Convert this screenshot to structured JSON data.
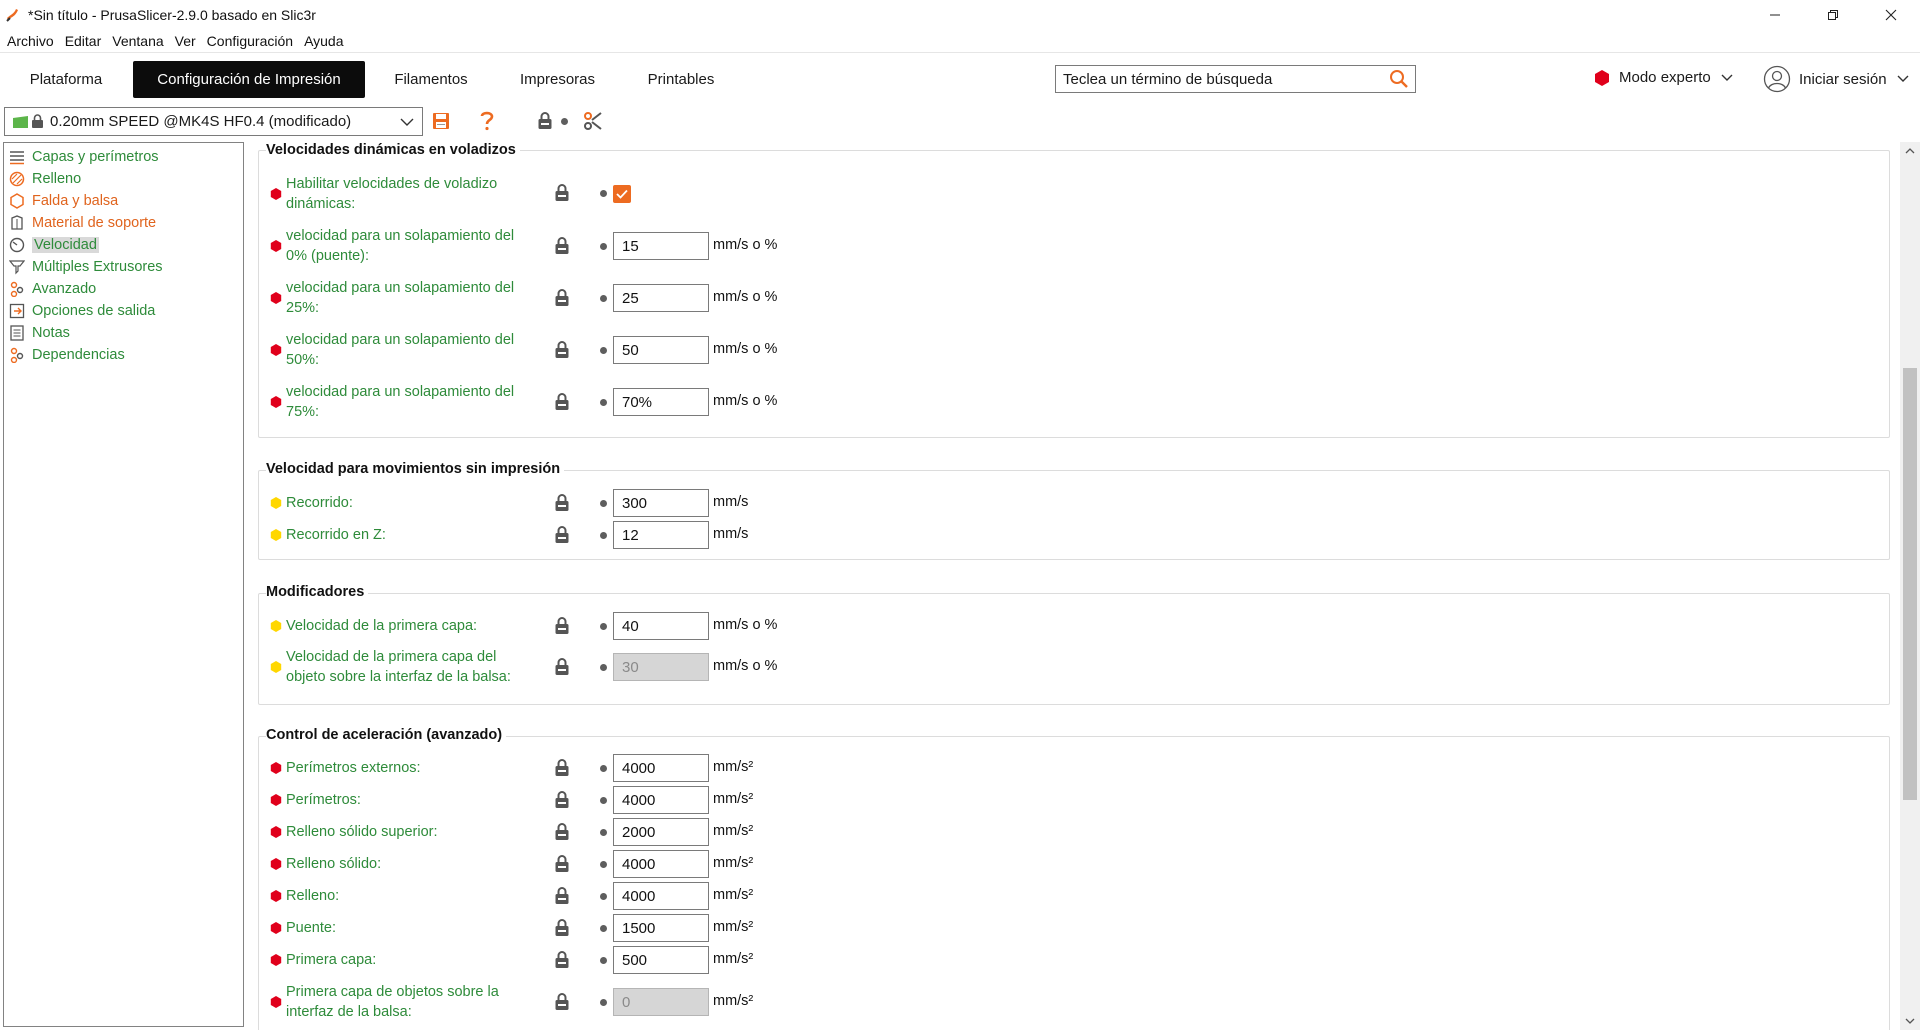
{
  "window": {
    "title": "*Sin título - PrusaSlicer-2.9.0 basado en Slic3r",
    "controls": [
      "minimize-icon",
      "restore-icon",
      "close-icon"
    ]
  },
  "menu": [
    "Archivo",
    "Editar",
    "Ventana",
    "Ver",
    "Configuración",
    "Ayuda"
  ],
  "tabs": [
    {
      "label": "Plataforma",
      "active": false
    },
    {
      "label": "Configuración de Impresión",
      "active": true
    },
    {
      "label": "Filamentos",
      "active": false
    },
    {
      "label": "Impresoras",
      "active": false
    },
    {
      "label": "Printables",
      "active": false
    }
  ],
  "search": {
    "placeholder": "Teclea un término de búsqueda"
  },
  "mode": {
    "label": "Modo experto",
    "color": "#e0001b"
  },
  "login": {
    "label": "Iniciar sesión"
  },
  "preset": {
    "value": "0.20mm SPEED @MK4S HF0.4 (modificado)",
    "flag_color": "#5cb54a"
  },
  "sidebar": {
    "items": [
      {
        "label": "Capas y perímetros",
        "color": "green",
        "icon": "layers-icon",
        "selected": false
      },
      {
        "label": "Relleno",
        "color": "green",
        "icon": "infill-icon",
        "selected": false
      },
      {
        "label": "Falda y balsa",
        "color": "orange",
        "icon": "skirt-icon",
        "selected": false
      },
      {
        "label": "Material de soporte",
        "color": "orange",
        "icon": "support-icon",
        "selected": false
      },
      {
        "label": "Velocidad",
        "color": "green",
        "icon": "speed-icon",
        "selected": true
      },
      {
        "label": "Múltiples Extrusores",
        "color": "green",
        "icon": "extruder-icon",
        "selected": false
      },
      {
        "label": "Avanzado",
        "color": "green",
        "icon": "advanced-icon",
        "selected": false
      },
      {
        "label": "Opciones de salida",
        "color": "green",
        "icon": "output-icon",
        "selected": false
      },
      {
        "label": "Notas",
        "color": "green",
        "icon": "notes-icon",
        "selected": false
      },
      {
        "label": "Dependencias",
        "color": "green",
        "icon": "dependencies-icon",
        "selected": false
      }
    ]
  },
  "groups": {
    "g1": {
      "title": "Velocidades dinámicas en voladizos",
      "options": {
        "o1": {
          "label": "Habilitar velocidades de voladizo dinámicas:",
          "checked": true,
          "level": "expert"
        },
        "o2": {
          "label": "velocidad para un solapamiento del 0% (puente):",
          "value": "15",
          "unit": "mm/s o %",
          "level": "expert"
        },
        "o3": {
          "label": "velocidad para un solapamiento del 25%:",
          "value": "25",
          "unit": "mm/s o %",
          "level": "expert"
        },
        "o4": {
          "label": "velocidad para un solapamiento del 50%:",
          "value": "50",
          "unit": "mm/s o %",
          "level": "expert"
        },
        "o5": {
          "label": "velocidad para un solapamiento del 75%:",
          "value": "70%",
          "unit": "mm/s o %",
          "level": "expert"
        }
      }
    },
    "g2": {
      "title": "Velocidad para movimientos sin impresión",
      "options": {
        "o1": {
          "label": "Recorrido:",
          "value": "300",
          "unit": "mm/s",
          "level": "advanced"
        },
        "o2": {
          "label": "Recorrido en Z:",
          "value": "12",
          "unit": "mm/s",
          "level": "advanced"
        }
      }
    },
    "g3": {
      "title": "Modificadores",
      "options": {
        "o1": {
          "label": "Velocidad de la primera capa:",
          "value": "40",
          "unit": "mm/s o %",
          "level": "advanced"
        },
        "o2": {
          "label": "Velocidad de la primera capa del objeto sobre la interfaz de la balsa:",
          "value": "30",
          "unit": "mm/s o %",
          "level": "advanced",
          "disabled": true
        }
      }
    },
    "g4": {
      "title": "Control de aceleración (avanzado)",
      "options": {
        "o1": {
          "label": "Perímetros externos:",
          "value": "4000",
          "unit": "mm/s²",
          "level": "expert"
        },
        "o2": {
          "label": "Perímetros:",
          "value": "4000",
          "unit": "mm/s²",
          "level": "expert"
        },
        "o3": {
          "label": "Relleno sólido superior:",
          "value": "2000",
          "unit": "mm/s²",
          "level": "expert"
        },
        "o4": {
          "label": "Relleno sólido:",
          "value": "4000",
          "unit": "mm/s²",
          "level": "expert"
        },
        "o5": {
          "label": "Relleno:",
          "value": "4000",
          "unit": "mm/s²",
          "level": "expert"
        },
        "o6": {
          "label": "Puente:",
          "value": "1500",
          "unit": "mm/s²",
          "level": "expert"
        },
        "o7": {
          "label": "Primera capa:",
          "value": "500",
          "unit": "mm/s²",
          "level": "expert"
        },
        "o8": {
          "label": "Primera capa de objetos sobre la interfaz de la balsa:",
          "value": "0",
          "unit": "mm/s²",
          "level": "expert",
          "disabled": true
        }
      }
    }
  },
  "colors": {
    "expert": "#e0001b",
    "advanced": "#ffd700",
    "accent": "#ed6b21",
    "label_green": "#2e8b3a",
    "label_orange": "#e0641e"
  }
}
